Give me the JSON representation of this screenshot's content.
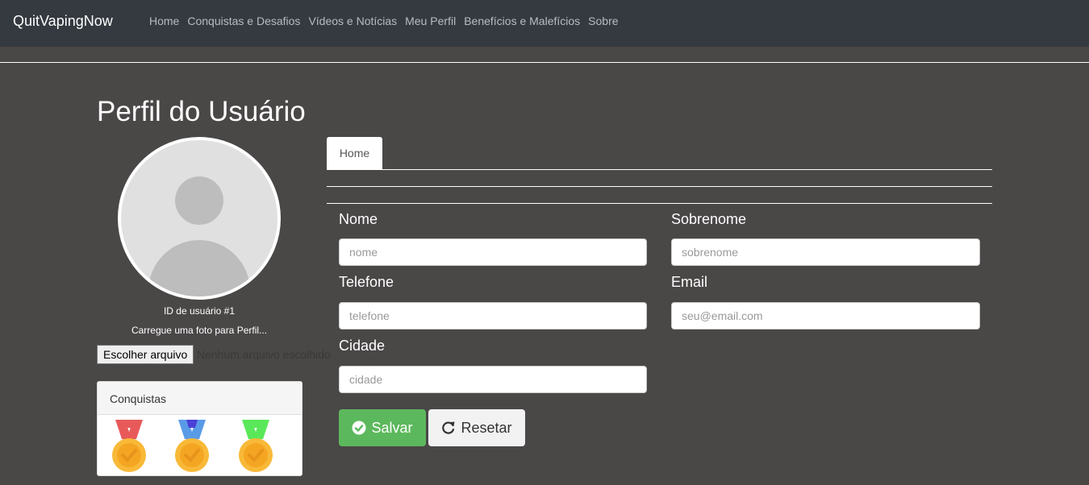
{
  "navbar": {
    "brand": "QuitVapingNow",
    "links": [
      "Home",
      "Conquistas e Desafios",
      "Vídeos e Notícias",
      "Meu Perfil",
      "Benefícios e Malefícios",
      "Sobre"
    ]
  },
  "profile": {
    "title": "Perfil do Usuário",
    "user_id": "ID de usuário #1",
    "upload_hint": "Carregue uma foto para Perfil...",
    "file_button": "Escolher arquivo",
    "file_status": "Nenhum arquivo escolhido"
  },
  "achievements": {
    "title": "Conquistas",
    "medals": [
      {
        "icon": "medal-icon",
        "ribbon": "#e85a5a",
        "ribbon_mid": "#e85a5a"
      },
      {
        "icon": "medal-icon",
        "ribbon": "#5a9be8",
        "ribbon_mid": "#4b3fd6"
      },
      {
        "icon": "medal-icon",
        "ribbon": "#5ae85a",
        "ribbon_mid": "#5ae85a"
      }
    ]
  },
  "tabs": [
    "Home"
  ],
  "form": {
    "nome": {
      "label": "Nome",
      "placeholder": "nome"
    },
    "sobrenome": {
      "label": "Sobrenome",
      "placeholder": "sobrenome"
    },
    "telefone": {
      "label": "Telefone",
      "placeholder": "telefone"
    },
    "email": {
      "label": "Email",
      "placeholder": "seu@email.com"
    },
    "cidade": {
      "label": "Cidade",
      "placeholder": "cidade"
    }
  },
  "buttons": {
    "save": {
      "label": "Salvar",
      "icon": "check-circle-icon",
      "color": "#5cb85c"
    },
    "reset": {
      "label": "Resetar",
      "icon": "refresh-icon"
    }
  }
}
